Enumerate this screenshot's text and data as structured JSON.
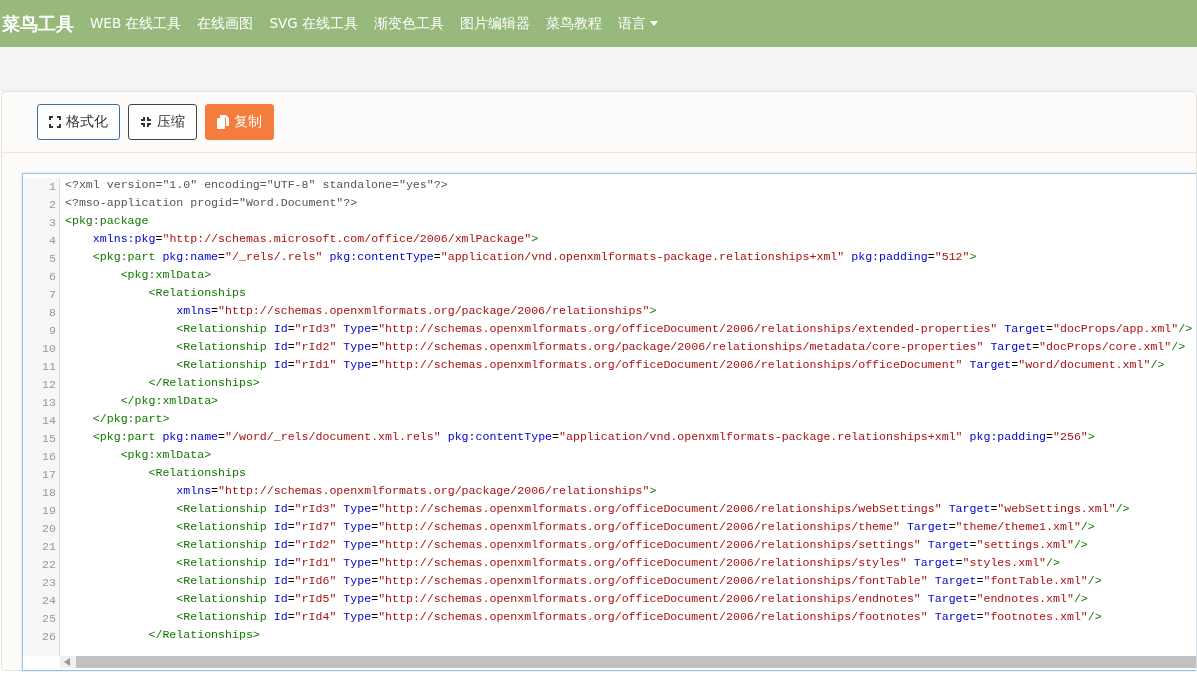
{
  "navbar": {
    "logo": "菜鸟工具",
    "items": [
      {
        "label": "WEB 在线工具",
        "kind": "link"
      },
      {
        "label": "在线画图",
        "kind": "link"
      },
      {
        "label": "SVG 在线工具",
        "kind": "link"
      },
      {
        "label": "渐变色工具",
        "kind": "link"
      },
      {
        "label": "图片编辑器",
        "kind": "link"
      },
      {
        "label": "菜鸟教程",
        "kind": "link"
      },
      {
        "label": "语言",
        "kind": "dropdown"
      }
    ]
  },
  "toolbar": {
    "buttons": [
      {
        "label": "格式化",
        "kind": "format"
      },
      {
        "label": "压缩",
        "kind": "compress"
      },
      {
        "label": "复制",
        "kind": "copy"
      }
    ]
  },
  "editor": {
    "lines": [
      {
        "number": "1",
        "tokens": [
          {
            "kind": "meta",
            "text": "<?xml version=\"1.0\" encoding=\"UTF-8\" standalone=\"yes\"?>"
          }
        ]
      },
      {
        "number": "2",
        "tokens": [
          {
            "kind": "meta",
            "text": "<?mso-application progid=\"Word.Document\"?>"
          }
        ]
      },
      {
        "number": "3",
        "tokens": [
          {
            "kind": "tag",
            "text": "<pkg:package"
          }
        ]
      },
      {
        "number": "4",
        "tokens": [
          {
            "kind": "attr",
            "text": "    xmlns:pkg"
          },
          {
            "kind": "punct",
            "text": "="
          },
          {
            "kind": "value",
            "text": "\"http://schemas.microsoft.com/office/2006/xmlPackage\""
          },
          {
            "kind": "tag",
            "text": ">"
          }
        ]
      },
      {
        "number": "5",
        "tokens": [
          {
            "kind": "tag",
            "text": "    <pkg:part"
          },
          {
            "kind": "attr",
            "text": " pkg:name"
          },
          {
            "kind": "punct",
            "text": "="
          },
          {
            "kind": "value",
            "text": "\"/_rels/.rels\""
          },
          {
            "kind": "attr",
            "text": " pkg:contentType"
          },
          {
            "kind": "punct",
            "text": "="
          },
          {
            "kind": "value",
            "text": "\"application/vnd.openxmlformats-package.relationships+xml\""
          },
          {
            "kind": "attr",
            "text": " pkg:padding"
          },
          {
            "kind": "punct",
            "text": "="
          },
          {
            "kind": "value",
            "text": "\"512\""
          },
          {
            "kind": "tag",
            "text": ">"
          }
        ]
      },
      {
        "number": "6",
        "tokens": [
          {
            "kind": "tag",
            "text": "        <pkg:xmlData>"
          }
        ]
      },
      {
        "number": "7",
        "tokens": [
          {
            "kind": "tag",
            "text": "            <Relationships"
          }
        ]
      },
      {
        "number": "8",
        "tokens": [
          {
            "kind": "attr",
            "text": "                xmlns"
          },
          {
            "kind": "punct",
            "text": "="
          },
          {
            "kind": "value",
            "text": "\"http://schemas.openxmlformats.org/package/2006/relationships\""
          },
          {
            "kind": "tag",
            "text": ">"
          }
        ]
      },
      {
        "number": "9",
        "tokens": [
          {
            "kind": "tag",
            "text": "                <Relationship"
          },
          {
            "kind": "attr",
            "text": " Id"
          },
          {
            "kind": "punct",
            "text": "="
          },
          {
            "kind": "value",
            "text": "\"rId3\""
          },
          {
            "kind": "attr",
            "text": " Type"
          },
          {
            "kind": "punct",
            "text": "="
          },
          {
            "kind": "value",
            "text": "\"http://schemas.openxmlformats.org/officeDocument/2006/relationships/extended-properties\""
          },
          {
            "kind": "attr",
            "text": " Target"
          },
          {
            "kind": "punct",
            "text": "="
          },
          {
            "kind": "value",
            "text": "\"docProps/app.xml\""
          },
          {
            "kind": "tag",
            "text": "/>"
          }
        ]
      },
      {
        "number": "10",
        "tokens": [
          {
            "kind": "tag",
            "text": "                <Relationship"
          },
          {
            "kind": "attr",
            "text": " Id"
          },
          {
            "kind": "punct",
            "text": "="
          },
          {
            "kind": "value",
            "text": "\"rId2\""
          },
          {
            "kind": "attr",
            "text": " Type"
          },
          {
            "kind": "punct",
            "text": "="
          },
          {
            "kind": "value",
            "text": "\"http://schemas.openxmlformats.org/package/2006/relationships/metadata/core-properties\""
          },
          {
            "kind": "attr",
            "text": " Target"
          },
          {
            "kind": "punct",
            "text": "="
          },
          {
            "kind": "value",
            "text": "\"docProps/core.xml\""
          },
          {
            "kind": "tag",
            "text": "/>"
          }
        ]
      },
      {
        "number": "11",
        "tokens": [
          {
            "kind": "tag",
            "text": "                <Relationship"
          },
          {
            "kind": "attr",
            "text": " Id"
          },
          {
            "kind": "punct",
            "text": "="
          },
          {
            "kind": "value",
            "text": "\"rId1\""
          },
          {
            "kind": "attr",
            "text": " Type"
          },
          {
            "kind": "punct",
            "text": "="
          },
          {
            "kind": "value",
            "text": "\"http://schemas.openxmlformats.org/officeDocument/2006/relationships/officeDocument\""
          },
          {
            "kind": "attr",
            "text": " Target"
          },
          {
            "kind": "punct",
            "text": "="
          },
          {
            "kind": "value",
            "text": "\"word/document.xml\""
          },
          {
            "kind": "tag",
            "text": "/>"
          }
        ]
      },
      {
        "number": "12",
        "tokens": [
          {
            "kind": "tag",
            "text": "            </Relationships>"
          }
        ]
      },
      {
        "number": "13",
        "tokens": [
          {
            "kind": "tag",
            "text": "        </pkg:xmlData>"
          }
        ]
      },
      {
        "number": "14",
        "tokens": [
          {
            "kind": "tag",
            "text": "    </pkg:part>"
          }
        ]
      },
      {
        "number": "15",
        "tokens": [
          {
            "kind": "tag",
            "text": "    <pkg:part"
          },
          {
            "kind": "attr",
            "text": " pkg:name"
          },
          {
            "kind": "punct",
            "text": "="
          },
          {
            "kind": "value",
            "text": "\"/word/_rels/document.xml.rels\""
          },
          {
            "kind": "attr",
            "text": " pkg:contentType"
          },
          {
            "kind": "punct",
            "text": "="
          },
          {
            "kind": "value",
            "text": "\"application/vnd.openxmlformats-package.relationships+xml\""
          },
          {
            "kind": "attr",
            "text": " pkg:padding"
          },
          {
            "kind": "punct",
            "text": "="
          },
          {
            "kind": "value",
            "text": "\"256\""
          },
          {
            "kind": "tag",
            "text": ">"
          }
        ]
      },
      {
        "number": "16",
        "tokens": [
          {
            "kind": "tag",
            "text": "        <pkg:xmlData>"
          }
        ]
      },
      {
        "number": "17",
        "tokens": [
          {
            "kind": "tag",
            "text": "            <Relationships"
          }
        ]
      },
      {
        "number": "18",
        "tokens": [
          {
            "kind": "attr",
            "text": "                xmlns"
          },
          {
            "kind": "punct",
            "text": "="
          },
          {
            "kind": "value",
            "text": "\"http://schemas.openxmlformats.org/package/2006/relationships\""
          },
          {
            "kind": "tag",
            "text": ">"
          }
        ]
      },
      {
        "number": "19",
        "tokens": [
          {
            "kind": "tag",
            "text": "                <Relationship"
          },
          {
            "kind": "attr",
            "text": " Id"
          },
          {
            "kind": "punct",
            "text": "="
          },
          {
            "kind": "value",
            "text": "\"rId3\""
          },
          {
            "kind": "attr",
            "text": " Type"
          },
          {
            "kind": "punct",
            "text": "="
          },
          {
            "kind": "value",
            "text": "\"http://schemas.openxmlformats.org/officeDocument/2006/relationships/webSettings\""
          },
          {
            "kind": "attr",
            "text": " Target"
          },
          {
            "kind": "punct",
            "text": "="
          },
          {
            "kind": "value",
            "text": "\"webSettings.xml\""
          },
          {
            "kind": "tag",
            "text": "/>"
          }
        ]
      },
      {
        "number": "20",
        "tokens": [
          {
            "kind": "tag",
            "text": "                <Relationship"
          },
          {
            "kind": "attr",
            "text": " Id"
          },
          {
            "kind": "punct",
            "text": "="
          },
          {
            "kind": "value",
            "text": "\"rId7\""
          },
          {
            "kind": "attr",
            "text": " Type"
          },
          {
            "kind": "punct",
            "text": "="
          },
          {
            "kind": "value",
            "text": "\"http://schemas.openxmlformats.org/officeDocument/2006/relationships/theme\""
          },
          {
            "kind": "attr",
            "text": " Target"
          },
          {
            "kind": "punct",
            "text": "="
          },
          {
            "kind": "value",
            "text": "\"theme/theme1.xml\""
          },
          {
            "kind": "tag",
            "text": "/>"
          }
        ]
      },
      {
        "number": "21",
        "tokens": [
          {
            "kind": "tag",
            "text": "                <Relationship"
          },
          {
            "kind": "attr",
            "text": " Id"
          },
          {
            "kind": "punct",
            "text": "="
          },
          {
            "kind": "value",
            "text": "\"rId2\""
          },
          {
            "kind": "attr",
            "text": " Type"
          },
          {
            "kind": "punct",
            "text": "="
          },
          {
            "kind": "value",
            "text": "\"http://schemas.openxmlformats.org/officeDocument/2006/relationships/settings\""
          },
          {
            "kind": "attr",
            "text": " Target"
          },
          {
            "kind": "punct",
            "text": "="
          },
          {
            "kind": "value",
            "text": "\"settings.xml\""
          },
          {
            "kind": "tag",
            "text": "/>"
          }
        ]
      },
      {
        "number": "22",
        "tokens": [
          {
            "kind": "tag",
            "text": "                <Relationship"
          },
          {
            "kind": "attr",
            "text": " Id"
          },
          {
            "kind": "punct",
            "text": "="
          },
          {
            "kind": "value",
            "text": "\"rId1\""
          },
          {
            "kind": "attr",
            "text": " Type"
          },
          {
            "kind": "punct",
            "text": "="
          },
          {
            "kind": "value",
            "text": "\"http://schemas.openxmlformats.org/officeDocument/2006/relationships/styles\""
          },
          {
            "kind": "attr",
            "text": " Target"
          },
          {
            "kind": "punct",
            "text": "="
          },
          {
            "kind": "value",
            "text": "\"styles.xml\""
          },
          {
            "kind": "tag",
            "text": "/>"
          }
        ]
      },
      {
        "number": "23",
        "tokens": [
          {
            "kind": "tag",
            "text": "                <Relationship"
          },
          {
            "kind": "attr",
            "text": " Id"
          },
          {
            "kind": "punct",
            "text": "="
          },
          {
            "kind": "value",
            "text": "\"rId6\""
          },
          {
            "kind": "attr",
            "text": " Type"
          },
          {
            "kind": "punct",
            "text": "="
          },
          {
            "kind": "value",
            "text": "\"http://schemas.openxmlformats.org/officeDocument/2006/relationships/fontTable\""
          },
          {
            "kind": "attr",
            "text": " Target"
          },
          {
            "kind": "punct",
            "text": "="
          },
          {
            "kind": "value",
            "text": "\"fontTable.xml\""
          },
          {
            "kind": "tag",
            "text": "/>"
          }
        ]
      },
      {
        "number": "24",
        "tokens": [
          {
            "kind": "tag",
            "text": "                <Relationship"
          },
          {
            "kind": "attr",
            "text": " Id"
          },
          {
            "kind": "punct",
            "text": "="
          },
          {
            "kind": "value",
            "text": "\"rId5\""
          },
          {
            "kind": "attr",
            "text": " Type"
          },
          {
            "kind": "punct",
            "text": "="
          },
          {
            "kind": "value",
            "text": "\"http://schemas.openxmlformats.org/officeDocument/2006/relationships/endnotes\""
          },
          {
            "kind": "attr",
            "text": " Target"
          },
          {
            "kind": "punct",
            "text": "="
          },
          {
            "kind": "value",
            "text": "\"endnotes.xml\""
          },
          {
            "kind": "tag",
            "text": "/>"
          }
        ]
      },
      {
        "number": "25",
        "tokens": [
          {
            "kind": "tag",
            "text": "                <Relationship"
          },
          {
            "kind": "attr",
            "text": " Id"
          },
          {
            "kind": "punct",
            "text": "="
          },
          {
            "kind": "value",
            "text": "\"rId4\""
          },
          {
            "kind": "attr",
            "text": " Type"
          },
          {
            "kind": "punct",
            "text": "="
          },
          {
            "kind": "value",
            "text": "\"http://schemas.openxmlformats.org/officeDocument/2006/relationships/footnotes\""
          },
          {
            "kind": "attr",
            "text": " Target"
          },
          {
            "kind": "punct",
            "text": "="
          },
          {
            "kind": "value",
            "text": "\"footnotes.xml\""
          },
          {
            "kind": "tag",
            "text": "/>"
          }
        ]
      },
      {
        "number": "26",
        "tokens": [
          {
            "kind": "tag",
            "text": "            </Relationships>"
          }
        ]
      }
    ]
  }
}
